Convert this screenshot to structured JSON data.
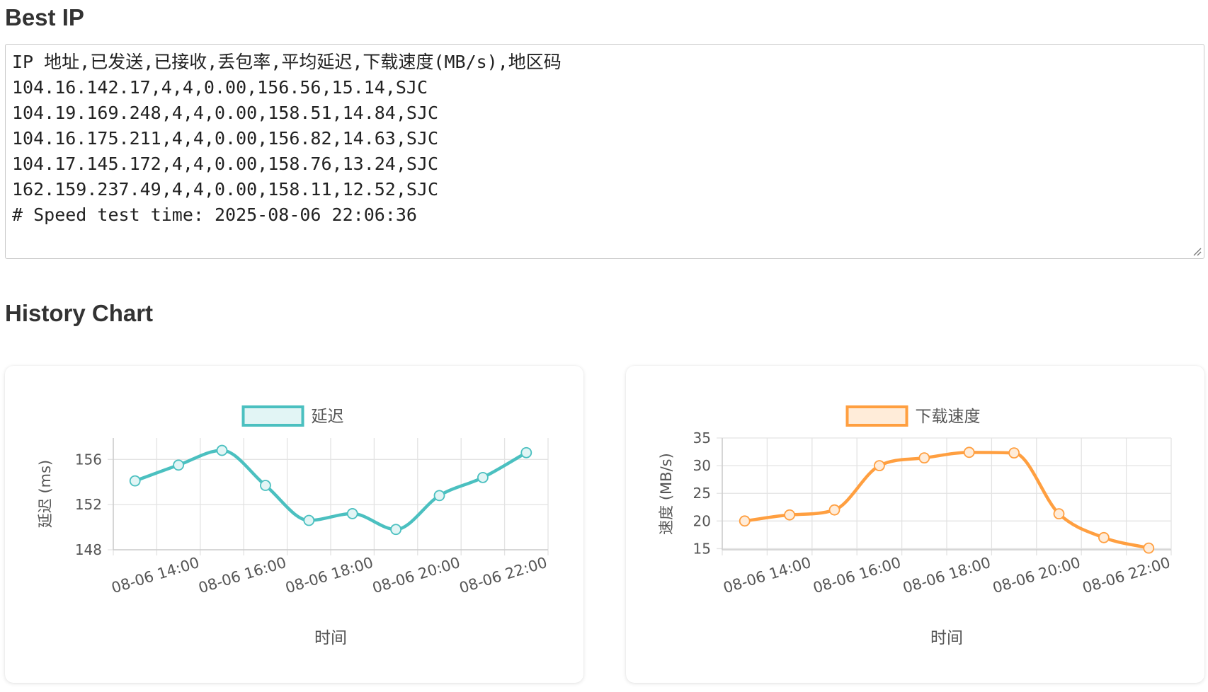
{
  "best_ip": {
    "heading": "Best IP",
    "results_text": "IP 地址,已发送,已接收,丢包率,平均延迟,下载速度(MB/s),地区码\n104.16.142.17,4,4,0.00,156.56,15.14,SJC\n104.19.169.248,4,4,0.00,158.51,14.84,SJC\n104.16.175.211,4,4,0.00,156.82,14.63,SJC\n104.17.145.172,4,4,0.00,158.76,13.24,SJC\n162.159.237.49,4,4,0.00,158.11,12.52,SJC\n# Speed test time: 2025-08-06 22:06:36"
  },
  "history": {
    "heading": "History Chart"
  },
  "chart_data": [
    {
      "type": "line",
      "legend": "延迟",
      "legend_position": "top",
      "xlabel": "时间",
      "ylabel": "延迟 (ms)",
      "color": "#4bc0c0",
      "fill_color": "#e2f5f5",
      "x": [
        "08-06 13:00",
        "08-06 14:00",
        "08-06 15:00",
        "08-06 16:00",
        "08-06 17:00",
        "08-06 18:00",
        "08-06 19:00",
        "08-06 20:00",
        "08-06 21:00",
        "08-06 22:00"
      ],
      "values": [
        154.1,
        155.5,
        156.8,
        153.7,
        150.6,
        151.2,
        149.8,
        152.8,
        154.4,
        156.6
      ],
      "x_ticks": [
        "08-06 14:00",
        "08-06 16:00",
        "08-06 18:00",
        "08-06 20:00",
        "08-06 22:00"
      ],
      "y_ticks": [
        148,
        152,
        156
      ],
      "ylim": [
        148,
        157.9
      ],
      "grid": true
    },
    {
      "type": "line",
      "legend": "下载速度",
      "legend_position": "top",
      "xlabel": "时间",
      "ylabel": "速度 (MB/s)",
      "color": "#ff9f40",
      "fill_color": "#ffecd9",
      "x": [
        "08-06 13:00",
        "08-06 14:00",
        "08-06 15:00",
        "08-06 16:00",
        "08-06 17:00",
        "08-06 18:00",
        "08-06 19:00",
        "08-06 20:00",
        "08-06 21:00",
        "08-06 22:00"
      ],
      "values": [
        20.0,
        21.1,
        22.0,
        30.0,
        31.4,
        32.4,
        32.3,
        21.3,
        17.0,
        15.1
      ],
      "x_ticks": [
        "08-06 14:00",
        "08-06 16:00",
        "08-06 18:00",
        "08-06 20:00",
        "08-06 22:00"
      ],
      "y_ticks": [
        15,
        20,
        25,
        30,
        35
      ],
      "ylim": [
        14.8,
        35
      ],
      "grid": true
    }
  ]
}
